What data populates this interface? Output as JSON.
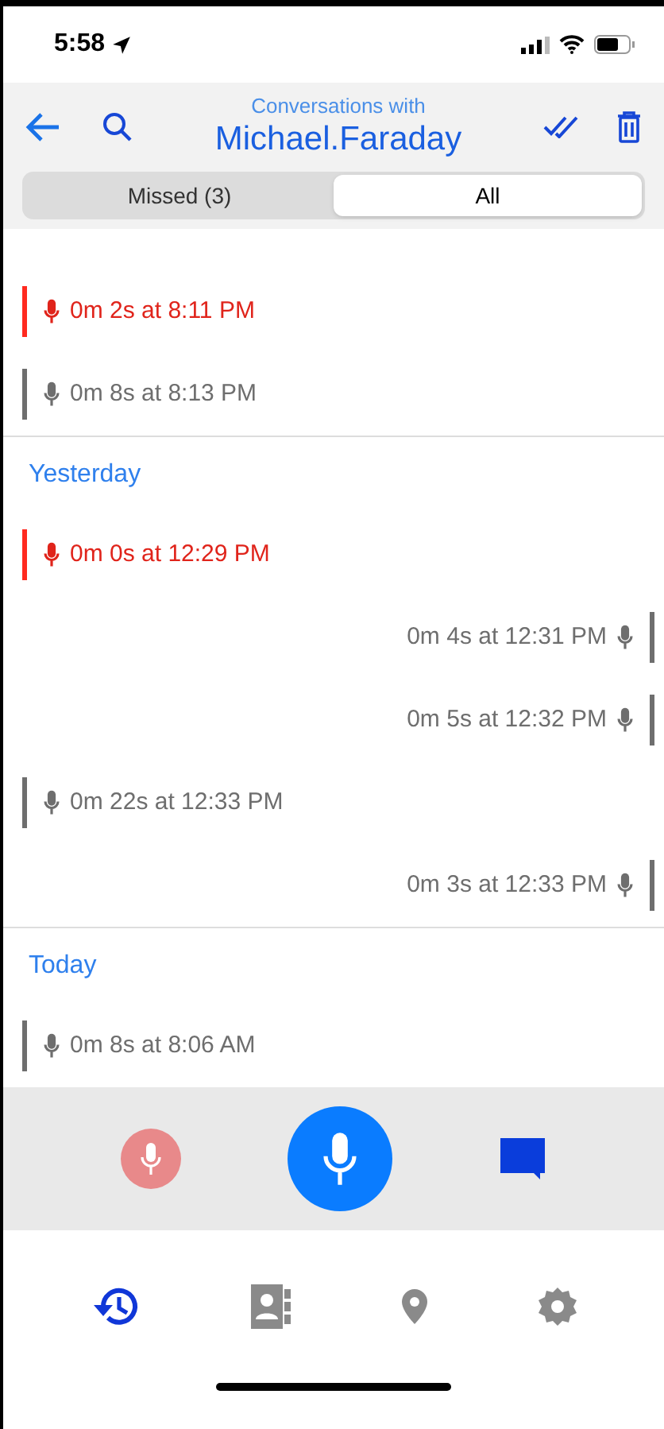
{
  "status_bar": {
    "time": "5:58"
  },
  "header": {
    "subtitle": "Conversations with",
    "title": "Michael.Faraday"
  },
  "segments": [
    {
      "label": "Missed (3)",
      "selected": false
    },
    {
      "label": "All",
      "selected": true
    }
  ],
  "sections": [
    {
      "messages": [
        {
          "kind": "incoming",
          "missed": true,
          "text": "0m 2s at 8:11 PM"
        },
        {
          "kind": "incoming",
          "missed": false,
          "text": "0m 8s at 8:13 PM"
        }
      ]
    },
    {
      "day": "Yesterday",
      "messages": [
        {
          "kind": "incoming",
          "missed": true,
          "text": "0m 0s at 12:29 PM"
        },
        {
          "kind": "outgoing",
          "missed": false,
          "text": "0m 4s at 12:31 PM"
        },
        {
          "kind": "outgoing",
          "missed": false,
          "text": "0m 5s at 12:32 PM"
        },
        {
          "kind": "incoming",
          "missed": false,
          "text": "0m 22s at 12:33 PM"
        },
        {
          "kind": "outgoing",
          "missed": false,
          "text": "0m 3s at 12:33 PM"
        }
      ]
    },
    {
      "day": "Today",
      "messages": [
        {
          "kind": "incoming",
          "missed": false,
          "text": "0m 8s at 8:06 AM"
        }
      ]
    }
  ],
  "tab_bar": [
    {
      "kind": "history",
      "selected": true
    },
    {
      "kind": "contacts",
      "selected": false
    },
    {
      "kind": "location",
      "selected": false
    },
    {
      "kind": "settings",
      "selected": false
    }
  ]
}
